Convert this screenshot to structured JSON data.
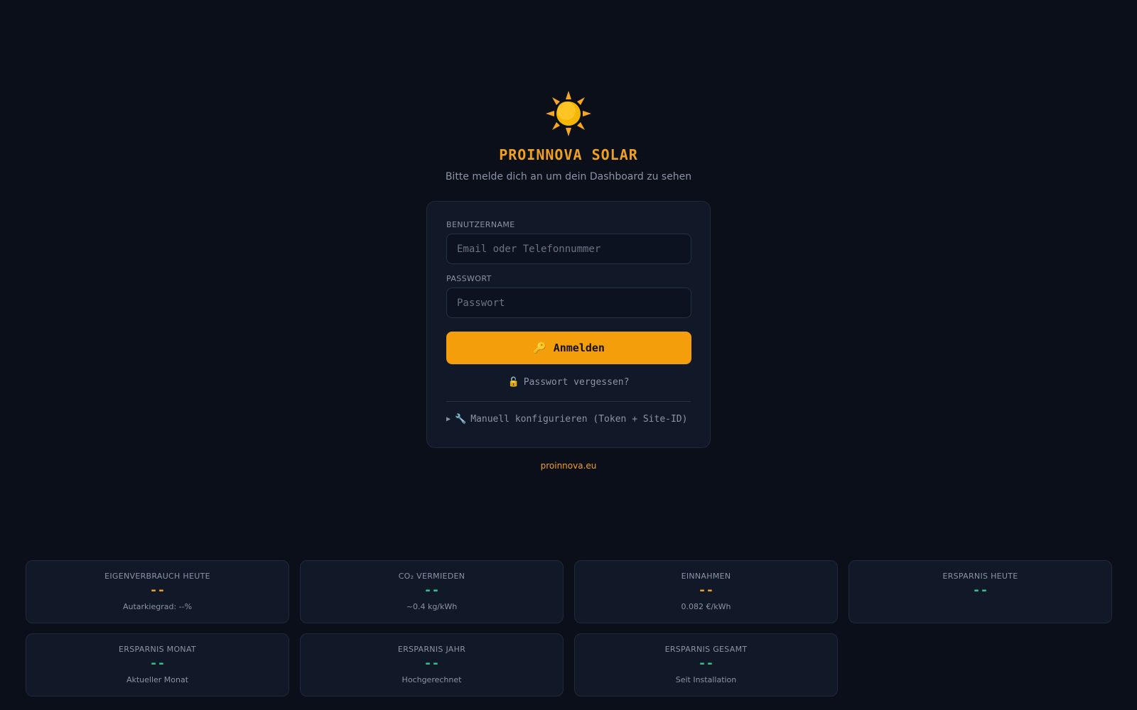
{
  "brand": {
    "name": "PROINNOVA SOLAR",
    "subtitle": "Bitte melde dich an um dein Dashboard zu sehen",
    "icon": "sun-icon"
  },
  "login": {
    "username_label": "BENUTZERNAME",
    "username_placeholder": "Email oder Telefonnummer",
    "password_label": "PASSWORT",
    "password_placeholder": "Passwort",
    "submit_label": "Anmelden",
    "forgot_label": "Passwort vergessen?",
    "manual_label": "Manuell konfigurieren (Token + Site-ID)"
  },
  "footer": {
    "link": "proinnova.eu"
  },
  "stats": [
    {
      "title": "EIGENVERBRAUCH HEUTE",
      "value": "--",
      "sub": "Autarkiegrad: --%",
      "color": "#f0a020"
    },
    {
      "title": "CO₂ VERMIEDEN",
      "value": "--",
      "sub": "~0.4 kg/kWh",
      "color": "#2bc48a"
    },
    {
      "title": "EINNAHMEN",
      "value": "--",
      "sub": "0.082 €/kWh",
      "color": "#f0a020"
    },
    {
      "title": "ERSPARNIS HEUTE",
      "value": "--",
      "sub": "",
      "color": "#2bc48a"
    },
    {
      "title": "ERSPARNIS MONAT",
      "value": "--",
      "sub": "Aktueller Monat",
      "color": "#2bc48a"
    },
    {
      "title": "ERSPARNIS JAHR",
      "value": "--",
      "sub": "Hochgerechnet",
      "color": "#2bc48a"
    },
    {
      "title": "ERSPARNIS GESAMT",
      "value": "--",
      "sub": "Seit Installation",
      "color": "#2bc48a"
    }
  ],
  "colors": {
    "accent": "#f59e0b",
    "brand": "#f0a020",
    "positive": "#2bc48a",
    "background": "#0b0f1a",
    "card": "#111827"
  }
}
